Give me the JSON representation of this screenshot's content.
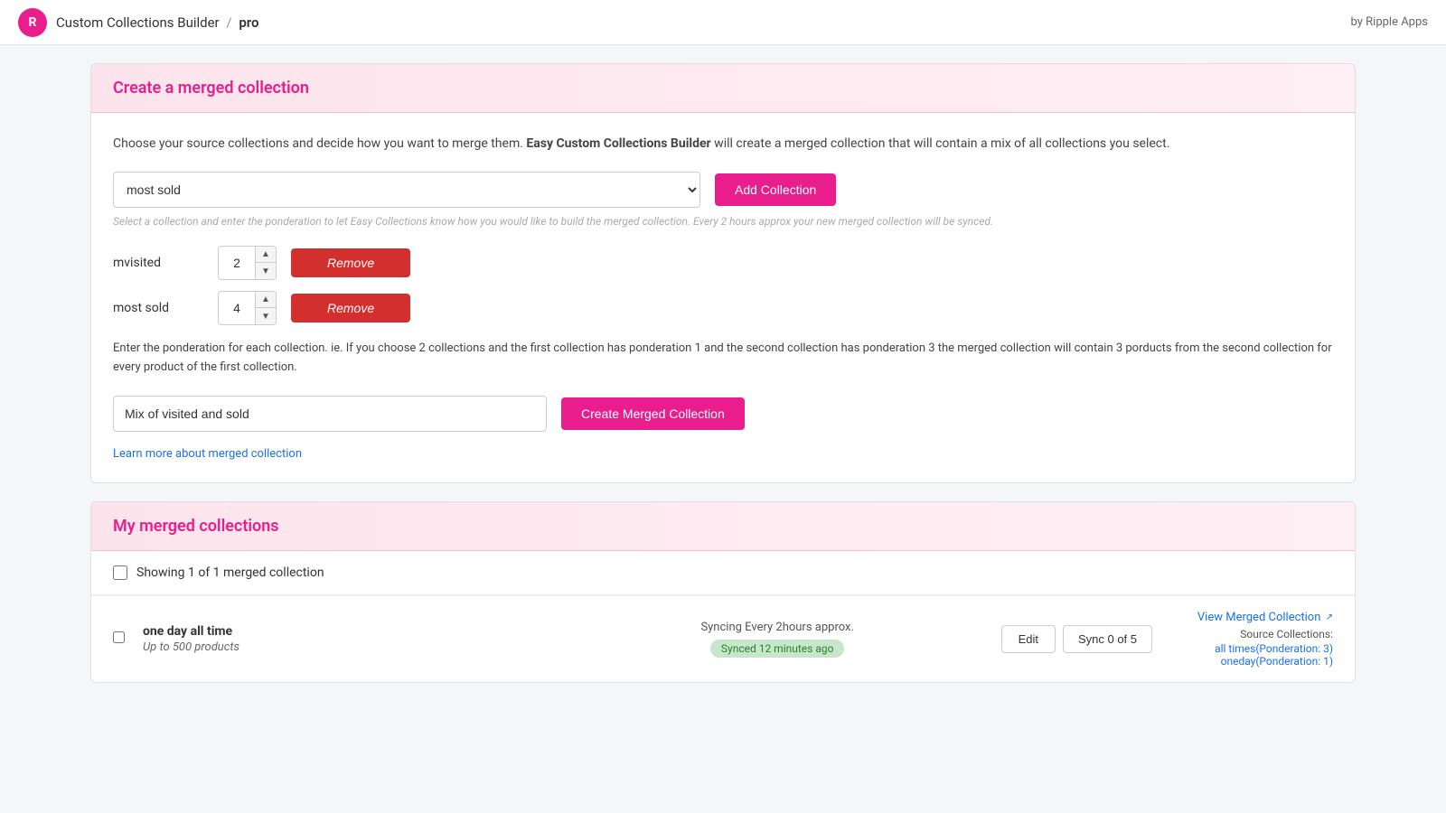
{
  "topbar": {
    "logo_text": "R",
    "app_name": "Custom Collections Builder",
    "separator": "/",
    "app_suffix": "pro",
    "byline": "by Ripple Apps"
  },
  "create_section": {
    "header": "Create a merged collection",
    "description_part1": "Choose your source collections and decide how you want to merge them. ",
    "description_bold": "Easy Custom Collections Builder",
    "description_part2": " will create a merged collection that will contain a mix of all collections you select.",
    "select_placeholder": "most sold",
    "add_button_label": "Add Collection",
    "hint_text": "Select a collection and enter the ponderation to let Easy Collections know how you would like to build the merged collection. Every 2 hours approx your new merged collection will be synced.",
    "collections": [
      {
        "name": "mvisited",
        "value": 2
      },
      {
        "name": "most sold",
        "value": 4
      }
    ],
    "remove_button_label": "Remove",
    "ponderation_text": "Enter the ponderation for each collection.  ie. If you choose 2 collections and the first collection has ponderation 1 and the second collection has ponderation 3 the merged collection will contain 3 porducts from the second collection for every product of the first collection.",
    "name_input_value": "Mix of visited and sold",
    "name_input_placeholder": "Mix of visited and sold",
    "create_button_label": "Create Merged Collection",
    "learn_more_text": "Learn more about merged collection",
    "learn_more_href": "#"
  },
  "my_collections_section": {
    "header": "My merged collections",
    "showing_text": "Showing 1 of 1 merged collection",
    "items": [
      {
        "name": "one day all time",
        "subtitle": "Up to 500 products",
        "sync_schedule": "Syncing Every 2hours approx.",
        "sync_status": "Synced 12 minutes ago",
        "edit_label": "Edit",
        "sync_label": "Sync 0 of 5",
        "view_link_text": "View Merged Collection",
        "source_collections_label": "Source Collections:",
        "sources": [
          {
            "text": "all times(Ponderation: 3)",
            "href": "#"
          },
          {
            "text": "oneday(Ponderation: 1)",
            "href": "#"
          }
        ]
      }
    ]
  }
}
